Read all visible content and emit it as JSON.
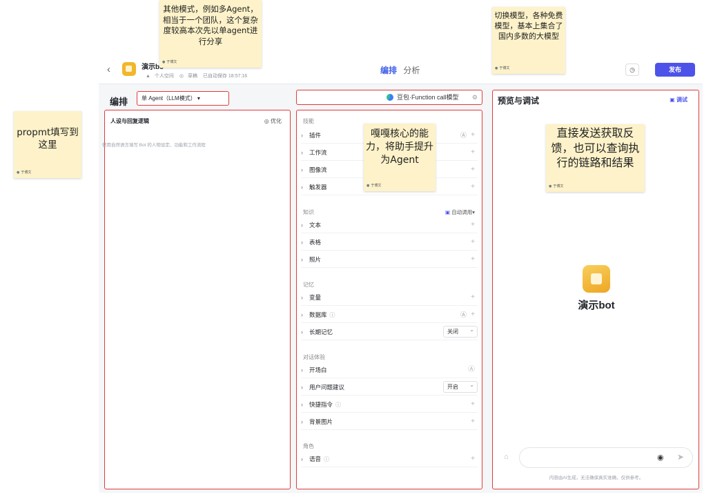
{
  "topbar": {
    "back_icon": "chevron-left-icon",
    "bot_name": "演示bc",
    "space": "个人空间",
    "status": "草稿",
    "autosave": "已自动保存 18:57:16",
    "tab_compose": "编排",
    "tab_analysis": "分析",
    "publish_label": "发布",
    "history_icon": "clock-icon"
  },
  "compose": {
    "title": "编排",
    "agent_mode": "单 Agent（LLM模式） ▾",
    "model_name": "豆包·Function call模型",
    "model_cfg_icon": "settings-icon"
  },
  "prompt_panel": {
    "header": "人设与回复逻辑",
    "optimize": "◎ 优化",
    "placeholder": "使用自然语言填写 Bot 的人物设定、功能和工作流程"
  },
  "skills_panel": {
    "sections": {
      "skills": "技能",
      "knowledge": "知识",
      "memory": "记忆",
      "dialog": "对话体验",
      "role": "角色"
    },
    "skills_items": [
      "插件",
      "工作流",
      "图像流",
      "触发器"
    ],
    "knowledge_items": [
      "文本",
      "表格",
      "照片"
    ],
    "knowledge_auto": "自动调用",
    "memory_items": [
      "变量",
      "数据库",
      "长期记忆"
    ],
    "long_memory_value": "关闭",
    "dialog_items": [
      "开场白",
      "用户问题建议",
      "快捷指令",
      "背景图片"
    ],
    "suggest_value": "开启",
    "role_items": [
      "语音"
    ]
  },
  "preview_panel": {
    "title": "预览与调试",
    "debug": "调试",
    "bot_name": "演示bot",
    "disclaimer": "内容由AI生成，无法确保真实准确，仅供参考。"
  },
  "notes": {
    "note1": "其他模式，例如多Agent，相当于一个团队，这个复杂度较高本次先以单agent进行分享",
    "note2": "切换模型，各种免费模型，基本上集合了国内多数的大模型",
    "note3": "propmt填写到这里",
    "note4": "嘎嘎核心的能力，将助手提升为Agent",
    "note5": "直接发送获取反馈，也可以查询执行的链路和结果",
    "author": "于博文"
  }
}
